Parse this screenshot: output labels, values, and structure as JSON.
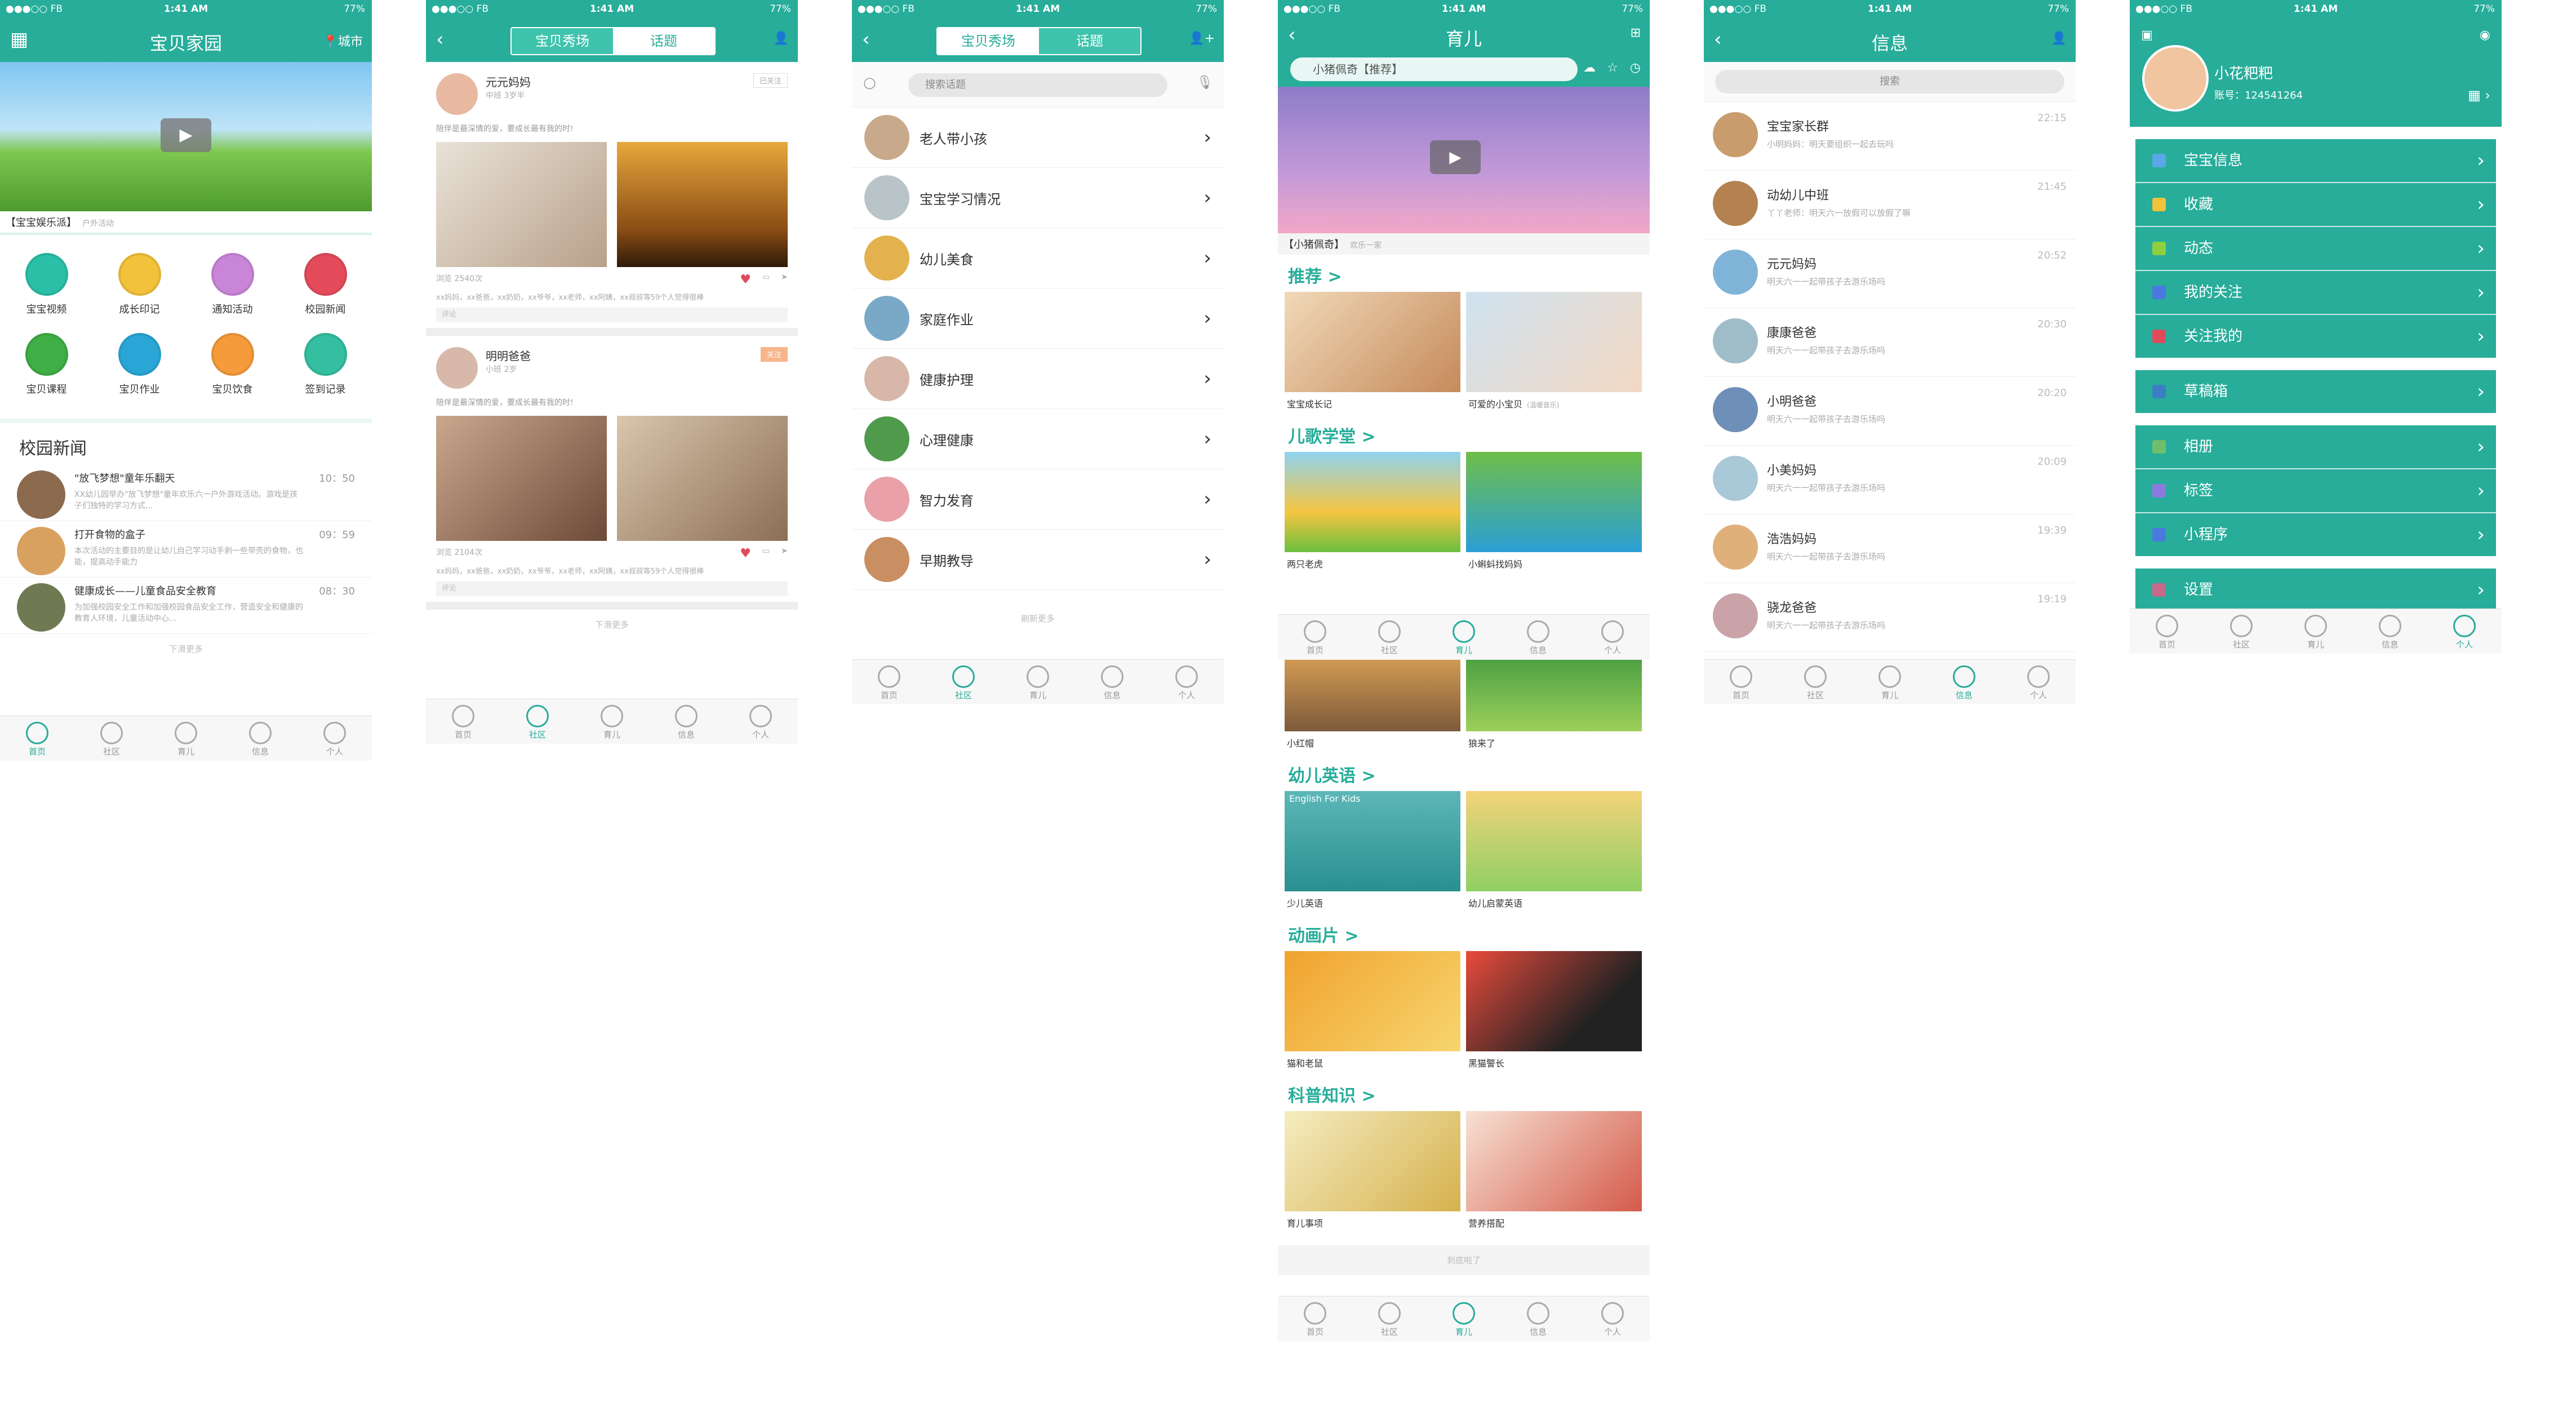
{
  "statusbar": {
    "carrier": "●●●○○ FB",
    "time": "1:41 AM",
    "battery": "77%"
  },
  "tabs": [
    "首页",
    "社区",
    "育儿",
    "信息",
    "个人"
  ],
  "colors": {
    "primary": "#27ad9a",
    "accent_red": "#e04b5c"
  },
  "s1": {
    "title": "宝贝家园",
    "city": "城市",
    "banner_caption": "【宝宝娱乐派】",
    "banner_sub": "户外活动",
    "grid": [
      "宝宝视频",
      "成长印记",
      "通知活动",
      "校园新闻",
      "宝贝课程",
      "宝贝作业",
      "宝贝饮食",
      "签到记录"
    ],
    "grid_colors": [
      "#2bbfa8",
      "#f2c23a",
      "#c985d8",
      "#e34b5b",
      "#3fae45",
      "#2aa6d6",
      "#f59b3b",
      "#33bfa0"
    ],
    "section_title": "校园新闻",
    "news": [
      {
        "title": "\"放飞梦想\"童年乐翻天",
        "desc": "XX幼儿园举办\"放飞梦想\"童年欢乐六一户外游戏活动。游戏是孩子们独特的学习方式...",
        "time": "10：50"
      },
      {
        "title": "打开食物的盒子",
        "desc": "本次活动的主要目的是让幼儿自己学习动手剥一些带壳的食物，也能，提高动手能力",
        "time": "09：59"
      },
      {
        "title": "健康成长——儿童食品安全教育",
        "desc": "为加强校园安全工作和加强校园食品安全工作，营造安全和健康的教育人环境，儿童活动中心...",
        "time": "08：30"
      }
    ],
    "more": "下滑更多"
  },
  "s2": {
    "seg_on": "宝贝秀场",
    "seg_off": "话题",
    "posts": [
      {
        "name": "元元妈妈",
        "sub": "中班  3岁半",
        "tag": "已关注",
        "text": "陪伴是最深情的爱，要成长最有我的时!",
        "views": "浏览 2540次",
        "likes": "xx妈妈，xx爸爸，xx奶奶，xx爷爷，xx老师，xx阿姨，xx叔叔等59个人觉得很棒",
        "comment": "评论"
      },
      {
        "name": "明明爸爸",
        "sub": "小班  2岁",
        "tag": "关注",
        "text": "陪伴是最深情的爱，要成长最有我的时!",
        "views": "浏览 2104次",
        "likes": "xx妈妈，xx爸爸，xx奶奶，xx爷爷，xx老师，xx阿姨，xx叔叔等59个人觉得很棒",
        "comment": "评论"
      }
    ],
    "more": "下滑更多"
  },
  "s3": {
    "seg_on": "宝贝秀场",
    "seg_off": "话题",
    "search_placeholder": "搜索话题",
    "topics": [
      "老人带小孩",
      "宝宝学习情况",
      "幼儿美食",
      "家庭作业",
      "健康护理",
      "心理健康",
      "智力发育",
      "早期教导"
    ],
    "more": "刷新更多"
  },
  "s4": {
    "title": "育儿",
    "search_placeholder": "小猪佩奇【推荐】",
    "video_caption": "【小猪佩奇】",
    "video_sub": "欢乐一家",
    "sections": [
      {
        "title": "推荐 >",
        "items": [
          "宝宝成长记",
          "可爱的小宝贝"
        ]
      },
      {
        "title": "儿歌学堂 >",
        "items": [
          "两只老虎",
          "小蝌蚪找妈妈",
          "小红帽",
          "狼来了"
        ]
      },
      {
        "title": "幼儿英语 >",
        "items": [
          "少儿英语",
          "幼儿启蒙英语"
        ]
      },
      {
        "title": "动画片 >",
        "items": [
          "猫和老鼠",
          "黑猫警长"
        ]
      },
      {
        "title": "科普知识 >",
        "items": [
          "育儿事项",
          "营养搭配"
        ]
      }
    ],
    "recommend_sub": "(温暖音乐)",
    "english_caption": "English For Kids",
    "footer": "到底啦了"
  },
  "s5": {
    "title": "信息",
    "search_placeholder": "搜索",
    "messages": [
      {
        "name": "宝宝家长群",
        "desc": "小明妈妈：明天要组织一起去玩吗",
        "time": "22:15"
      },
      {
        "name": "动幼儿中班",
        "desc": "丫丫老师：明天六一放假可以放假了嘛",
        "time": "21:45"
      },
      {
        "name": "元元妈妈",
        "desc": "明天六一一起带孩子去游乐场吗",
        "time": "20:52"
      },
      {
        "name": "康康爸爸",
        "desc": "明天六一一起带孩子去游乐场吗",
        "time": "20:30"
      },
      {
        "name": "小明爸爸",
        "desc": "明天六一一起带孩子去游乐场吗",
        "time": "20:20"
      },
      {
        "name": "小美妈妈",
        "desc": "明天六一一起带孩子去游乐场吗",
        "time": "20:09"
      },
      {
        "name": "浩浩妈妈",
        "desc": "明天六一一起带孩子去游乐场吗",
        "time": "19:39"
      },
      {
        "name": "骁龙爸爸",
        "desc": "明天六一一起带孩子去游乐场吗",
        "time": "19:19"
      }
    ]
  },
  "s6": {
    "name": "小花粑粑",
    "account": "账号：124541264",
    "group1": [
      "宝宝信息",
      "收藏",
      "动态",
      "我的关注",
      "关注我的"
    ],
    "group2": [
      "草稿箱"
    ],
    "group3": [
      "相册",
      "标签",
      "小程序"
    ],
    "group4": [
      "设置"
    ]
  }
}
